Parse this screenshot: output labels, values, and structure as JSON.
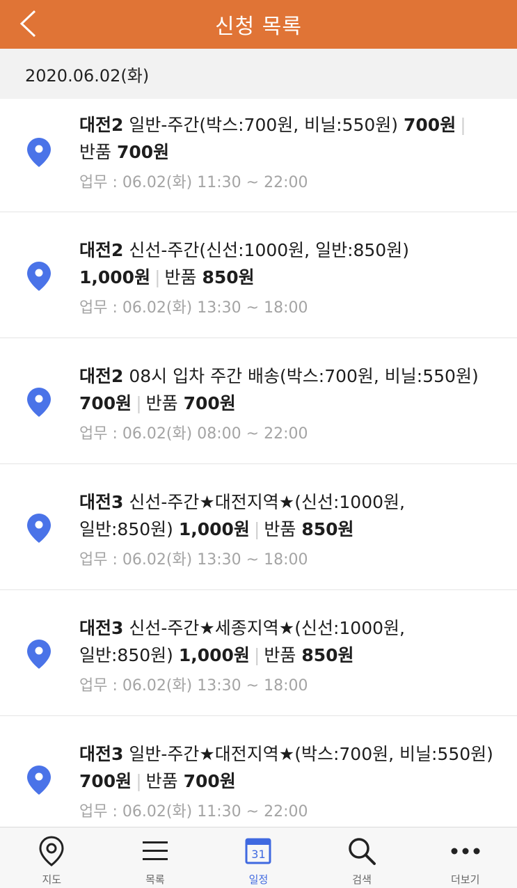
{
  "header": {
    "title": "신청 목록"
  },
  "date_label": "2020.06.02(화)",
  "colors": {
    "accent": "#e07436",
    "pin": "#4a73e8",
    "active_tab": "#3f69e0"
  },
  "items": [
    {
      "region": "대전2",
      "desc": "일반-주간(박스:700원, 비닐:550원)",
      "price": "700원",
      "separator": "|",
      "return_label": "반품",
      "return_price": "700원",
      "schedule": "업무 : 06.02(화) 11:30 ~ 22:00"
    },
    {
      "region": "대전2",
      "desc": "신선-주간(신선:1000원, 일반:850원)",
      "price": "1,000원",
      "separator": "|",
      "return_label": "반품",
      "return_price": "850원",
      "schedule": "업무 : 06.02(화) 13:30 ~ 18:00"
    },
    {
      "region": "대전2",
      "desc": "08시 입차 주간 배송(박스:700원, 비닐:550원)",
      "price": "700원",
      "separator": "|",
      "return_label": "반품",
      "return_price": "700원",
      "schedule": "업무 : 06.02(화) 08:00 ~ 22:00"
    },
    {
      "region": "대전3",
      "desc": "신선-주간★대전지역★(신선:1000원, 일반:850원)",
      "price": "1,000원",
      "separator": "|",
      "return_label": "반품",
      "return_price": "850원",
      "schedule": "업무 : 06.02(화) 13:30 ~ 18:00"
    },
    {
      "region": "대전3",
      "desc": "신선-주간★세종지역★(신선:1000원, 일반:850원)",
      "price": "1,000원",
      "separator": "|",
      "return_label": "반품",
      "return_price": "850원",
      "schedule": "업무 : 06.02(화) 13:30 ~ 18:00"
    },
    {
      "region": "대전3",
      "desc": "일반-주간★대전지역★(박스:700원, 비닐:550원)",
      "price": "700원",
      "separator": "|",
      "return_label": "반품",
      "return_price": "700원",
      "schedule": "업무 : 06.02(화) 11:30 ~ 22:00"
    }
  ],
  "tabbar": {
    "tabs": [
      {
        "label": "지도",
        "icon": "map-pin-icon",
        "active": false
      },
      {
        "label": "목록",
        "icon": "list-icon",
        "active": false
      },
      {
        "label": "일정",
        "icon": "calendar-icon",
        "active": true,
        "calendar_day": "31"
      },
      {
        "label": "검색",
        "icon": "search-icon",
        "active": false
      },
      {
        "label": "더보기",
        "icon": "more-icon",
        "active": false
      }
    ]
  }
}
